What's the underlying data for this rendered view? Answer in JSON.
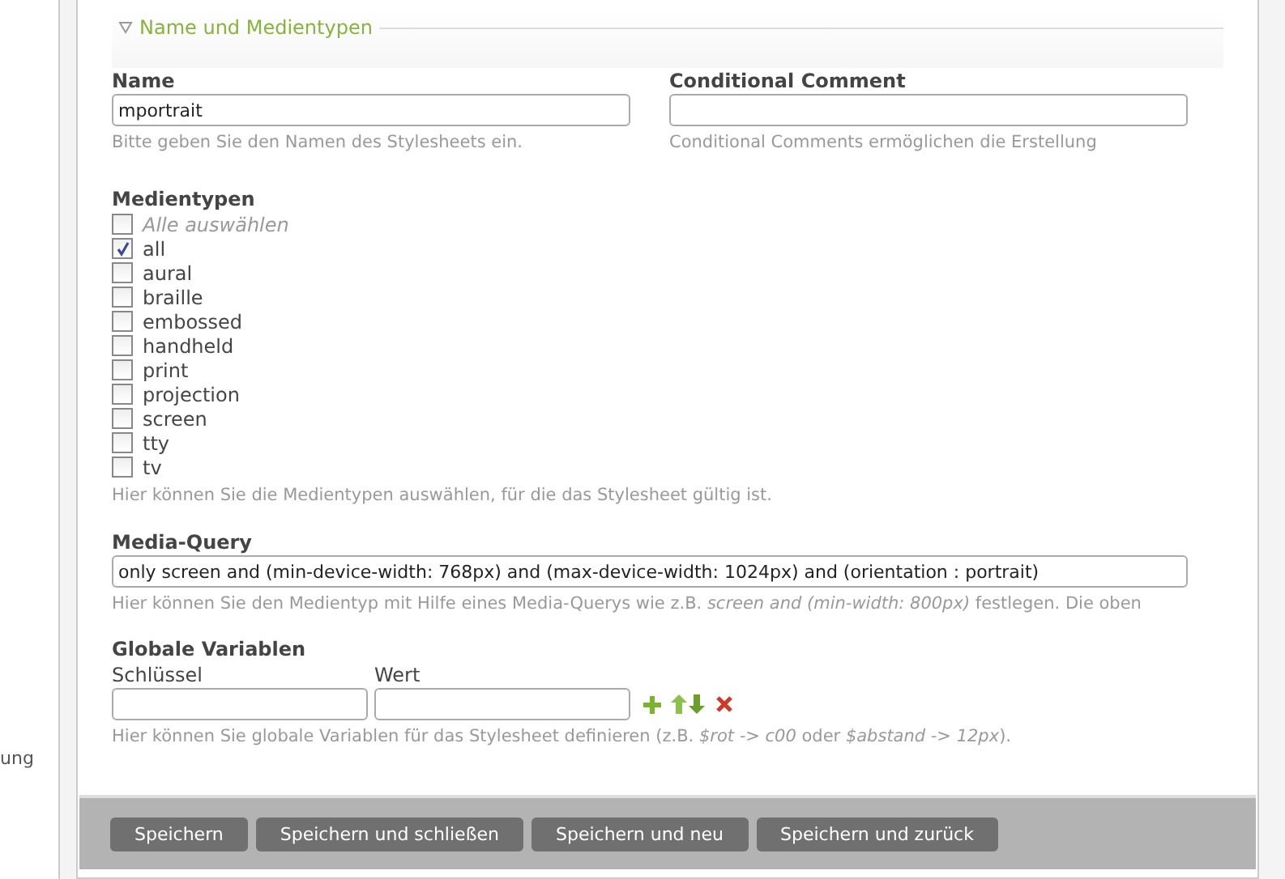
{
  "sidebar": {
    "fragment": "ung"
  },
  "section": {
    "title": "Name und Medientypen",
    "expanded": true
  },
  "name_field": {
    "label": "Name",
    "value": "mportrait",
    "help": "Bitte geben Sie den Namen des Stylesheets ein."
  },
  "comment_field": {
    "label": "Conditional Comment",
    "help": "Conditional Comments ermöglichen die Erstellung"
  },
  "media_types": {
    "label": "Medientypen",
    "items": [
      {
        "label": "Alle auswählen",
        "kind": "select-all",
        "checked": false
      },
      {
        "label": "all",
        "kind": "option",
        "checked": true
      },
      {
        "label": "aural",
        "kind": "option",
        "checked": false
      },
      {
        "label": "braille",
        "kind": "option",
        "checked": false
      },
      {
        "label": "embossed",
        "kind": "option",
        "checked": false
      },
      {
        "label": "handheld",
        "kind": "option",
        "checked": false
      },
      {
        "label": "print",
        "kind": "option",
        "checked": false
      },
      {
        "label": "projection",
        "kind": "option",
        "checked": false
      },
      {
        "label": "screen",
        "kind": "option",
        "checked": false
      },
      {
        "label": "tty",
        "kind": "option",
        "checked": false
      },
      {
        "label": "tv",
        "kind": "option",
        "checked": false
      }
    ],
    "help": "Hier können Sie die Medientypen auswählen, für die das Stylesheet gültig ist."
  },
  "media_query": {
    "label": "Media-Query",
    "value": "only screen and (min-device-width: 768px) and (max-device-width: 1024px) and (orientation : portrait)",
    "help": "Hier können Sie den Medientyp mit Hilfe eines Media-Querys wie z.B. *screen and (min-width: 800px)* festlegen. Die oben"
  },
  "variables": {
    "label": "Globale Variablen",
    "key_label": "Schlüssel",
    "value_label": "Wert",
    "help": "Hier können Sie globale Variablen für das Stylesheet definieren (z.B. *$rot -> c00* oder *$abstand -> 12px*)."
  },
  "buttons": [
    "Speichern",
    "Speichern und schließen",
    "Speichern und neu",
    "Speichern und zurück"
  ]
}
